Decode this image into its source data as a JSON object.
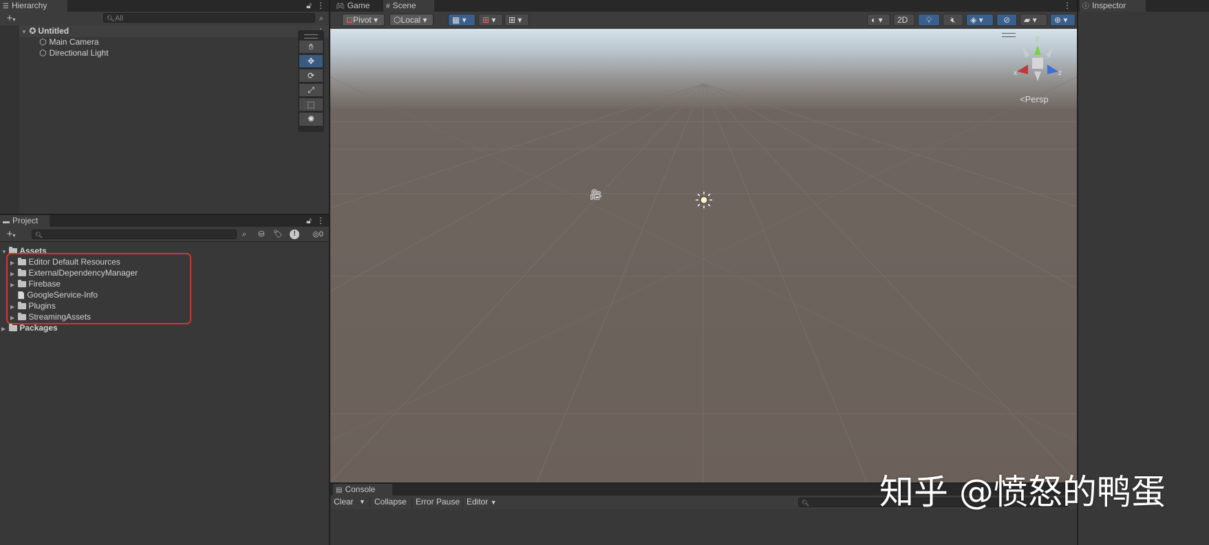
{
  "hierarchy": {
    "tab_label": "Hierarchy",
    "search_placeholder": "All",
    "scene_name": "Untitled",
    "objects": [
      "Main Camera",
      "Directional Light"
    ]
  },
  "project": {
    "tab_label": "Project",
    "hidden_count": "0",
    "assets_label": "Assets",
    "asset_items": [
      {
        "label": "Editor Default Resources",
        "kind": "folder"
      },
      {
        "label": "ExternalDependencyManager",
        "kind": "folder"
      },
      {
        "label": "Firebase",
        "kind": "folder"
      },
      {
        "label": "GoogleService-Info",
        "kind": "file"
      },
      {
        "label": "Plugins",
        "kind": "folder"
      },
      {
        "label": "StreamingAssets",
        "kind": "folder"
      }
    ],
    "packages_label": "Packages",
    "highlight_color": "#e0302a"
  },
  "center_tabs": {
    "game": "Game",
    "scene": "Scene"
  },
  "scene_toolbar": {
    "pivot": "Pivot",
    "local": "Local",
    "mode_2d": "2D"
  },
  "scene_view": {
    "persp_label": "Persp",
    "gizmo": {
      "y": "y",
      "x": "x",
      "z": "z"
    },
    "ground_color": "#6b615a",
    "sky_color": "#cfdbe4"
  },
  "inspector": {
    "tab_label": "Inspector"
  },
  "console": {
    "tab_label": "Console",
    "clear": "Clear",
    "collapse": "Collapse",
    "error_pause": "Error Pause",
    "editor": "Editor"
  },
  "watermark": "知乎 @愤怒的鸭蛋"
}
